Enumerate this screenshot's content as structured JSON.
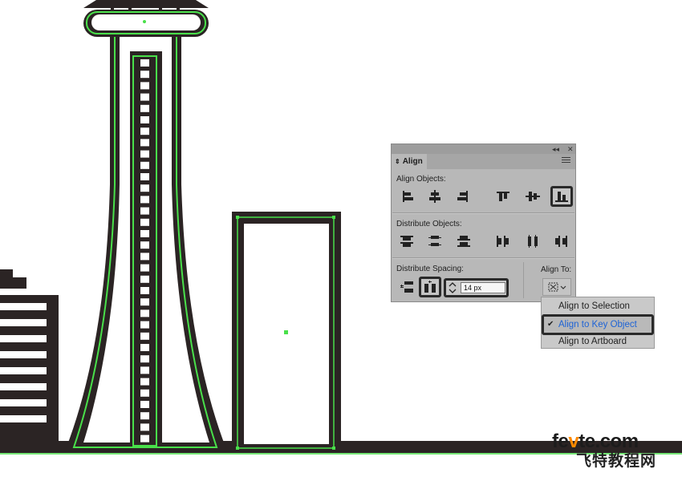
{
  "panel": {
    "tab_label": "Align",
    "collapse_glyph": "◂◂",
    "close_glyph": "✕",
    "tab_arrows_glyph": "⇕",
    "align_objects_label": "Align Objects:",
    "distribute_objects_label": "Distribute Objects:",
    "distribute_spacing_label": "Distribute Spacing:",
    "align_to_label": "Align To:",
    "spacing_value": "14 px"
  },
  "align_to_menu": {
    "items": [
      {
        "label": "Align to Selection",
        "selected": false
      },
      {
        "label": "Align to Key Object",
        "selected": true
      },
      {
        "label": "Align to Artboard",
        "selected": false
      }
    ],
    "check_glyph": "✔"
  },
  "watermark": {
    "line1_a": "fe",
    "line1_dot": "v",
    "line1_b": "te.com",
    "line2": "飞特教程网"
  },
  "colors": {
    "outline": "#2b2424",
    "highlight": "#49e04a",
    "panel_bg": "#b8b8b8",
    "selected_text": "#1d63d6"
  }
}
